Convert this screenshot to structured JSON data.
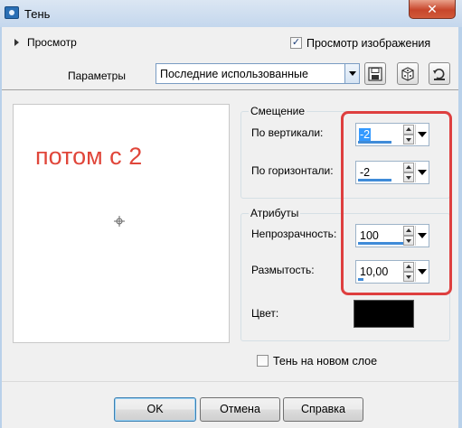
{
  "window": {
    "title": "Тень",
    "close_label": "✕"
  },
  "header": {
    "preview_toggle_label": "Просмотр",
    "image_preview_label": "Просмотр изображения",
    "image_preview_checked": "✓"
  },
  "presets": {
    "label": "Параметры",
    "selected": "Последние использованные"
  },
  "preview": {
    "annotation": "потом с 2"
  },
  "offset": {
    "title": "Смещение",
    "vertical_label": "По вертикали:",
    "vertical_value": "-2",
    "horizontal_label": "По горизонтали:",
    "horizontal_value": "-2"
  },
  "attributes": {
    "title": "Атрибуты",
    "opacity_label": "Непрозрачность:",
    "opacity_value": "100",
    "blur_label": "Размытость:",
    "blur_value": "10,00",
    "color_label": "Цвет:",
    "color_value": "#000000"
  },
  "shadow_new_layer": {
    "label": "Тень на новом слое"
  },
  "buttons": {
    "ok": "OK",
    "cancel": "Отмена",
    "help": "Справка"
  },
  "colors": {
    "annotation": "#e0463a",
    "highlight_box": "#de3f3f",
    "selection": "#3399ff"
  },
  "icons": [
    "save-preset-icon",
    "randomize-icon",
    "reset-icon",
    "crosshair-icon"
  ]
}
